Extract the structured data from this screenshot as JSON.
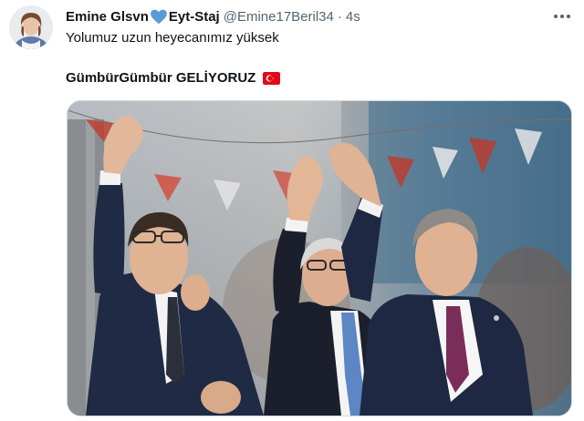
{
  "tweet": {
    "author": {
      "name_part1": "Emine Glsvn",
      "name_part2": "Eyt-Staj",
      "handle": "@Emine17Beril34",
      "separator": "·",
      "time": "4s",
      "avatar_icon": "profile-photo"
    },
    "text": {
      "line1": "Yolumuz uzun heyecanımız yüksek",
      "line2": "GümbürGümbür GELİYORUZ",
      "flag_icon": "turkey-flag-icon"
    },
    "media": {
      "kind": "photo"
    }
  },
  "colors": {
    "text_primary": "#0f1419",
    "text_secondary": "#536471",
    "heart_blue": "#5b9bd5",
    "flag_red": "#e30a17"
  }
}
